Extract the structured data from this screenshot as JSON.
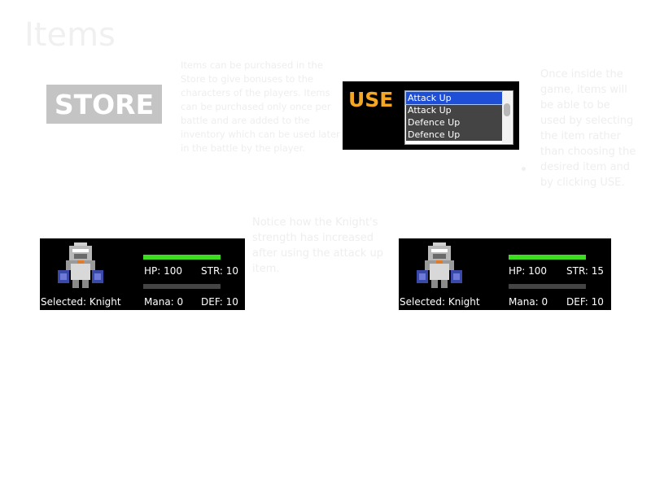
{
  "slide": {
    "title": "Items"
  },
  "store_button": {
    "label": "STORE"
  },
  "use_panel": {
    "label": "USE",
    "items": [
      "Attack Up",
      "Attack Up",
      "Defence Up",
      "Defence Up"
    ],
    "selected_index": 0
  },
  "text": {
    "p1": "Items can be purchased in the Store to give bonuses to the characters of the players. Items can be purchased only once per battle and are added to the inventory which can be used later in the battle by the player.",
    "p2": "Once inside the game, items will be able to be used by selecting the item rather than choosing the desired item and by clicking USE.",
    "p3": "Notice how the Knight's strength has increased after using the attack up item."
  },
  "hud_before": {
    "selected": "Selected: Knight",
    "hp": "HP: 100",
    "str": "STR: 10",
    "mana": "Mana: 0",
    "def": "DEF: 10",
    "hp_fill": 1.0,
    "mana_fill": 0.0
  },
  "hud_after": {
    "selected": "Selected: Knight",
    "hp": "HP: 100",
    "str": "STR: 15",
    "mana": "Mana: 0",
    "def": "DEF: 10",
    "hp_fill": 1.0,
    "mana_fill": 0.0
  },
  "colors": {
    "use_label": "#f5a623",
    "hp_bar": "#3cdc1e",
    "selection": "#1f4fd6"
  }
}
